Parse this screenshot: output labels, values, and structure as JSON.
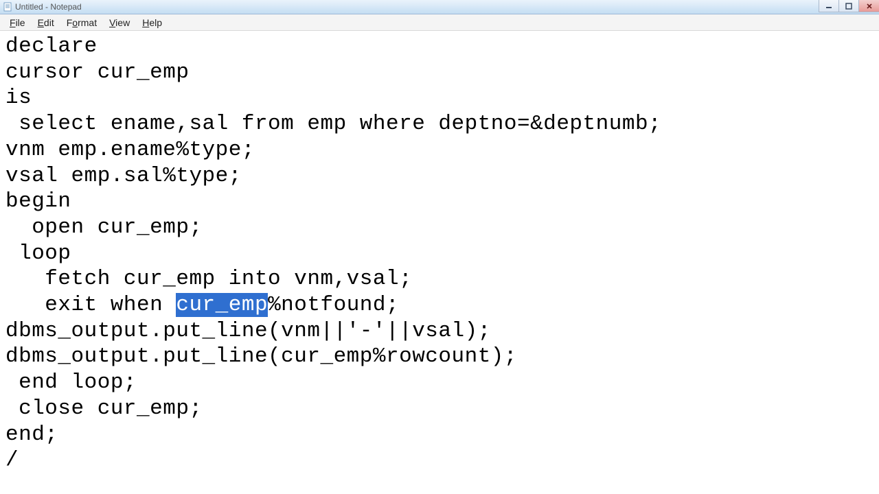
{
  "window": {
    "title": "Untitled - Notepad"
  },
  "menu": {
    "file": "File",
    "edit": "Edit",
    "format": "Format",
    "view": "View",
    "help": "Help"
  },
  "code": {
    "l1": "declare",
    "l2": "cursor cur_emp",
    "l3": "is",
    "l4": " select ename,sal from emp where deptno=&deptnumb;",
    "l5": "vnm emp.ename%type;",
    "l6": "vsal emp.sal%type;",
    "l7": "begin",
    "l8": "  open cur_emp;",
    "l9": " loop",
    "l10a": "   fetch cur_emp into vnm,vsal;",
    "l11_pre": "   exit when ",
    "l11_sel": "cur_emp",
    "l11_post": "%notfound;",
    "l12": "dbms_output.put_line(vnm||'-'||vsal);",
    "l13": "dbms_output.put_line(cur_emp%rowcount);",
    "l14": " end loop;",
    "l15": " close cur_emp;",
    "l16": "end;",
    "l17": "/"
  }
}
